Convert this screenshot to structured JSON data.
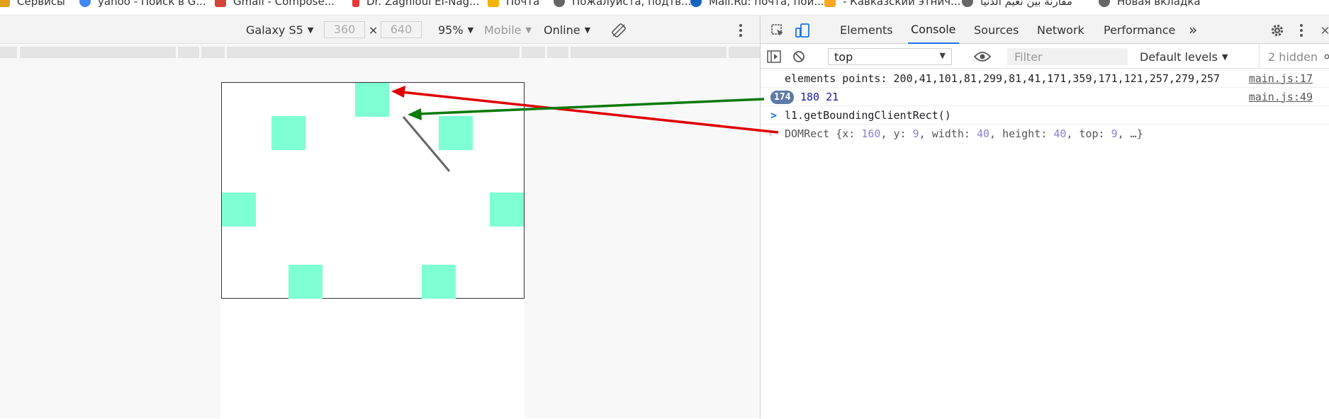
{
  "bookmarks": [
    {
      "label": "Сервисы",
      "color": "#e0a21b",
      "icon": "apps-grid-icon"
    },
    {
      "label": "yahoo - Поиск в G...",
      "color": "#4285f4",
      "icon": "google-icon"
    },
    {
      "label": "Gmail - Compose...",
      "color": "#d44638",
      "icon": "gmail-icon"
    },
    {
      "label": "Dr. Zaghloul El-Nag...",
      "color": "#e53935",
      "icon": "bookmark-icon"
    },
    {
      "label": "Почта",
      "color": "#f4b400",
      "icon": "mail-icon"
    },
    {
      "label": "Пожалуйста, подтв...",
      "color": "#666666",
      "icon": "globe-icon"
    },
    {
      "label": "Mail.Ru: почта, пои...",
      "color": "#1565c0",
      "icon": "mailru-icon"
    },
    {
      "label": "- Кавказский этнич...",
      "color": "#f9a825",
      "icon": "star-icon"
    },
    {
      "label": "مقارنة بين نعيم الدنيا",
      "color": "#666666",
      "icon": "globe-icon"
    },
    {
      "label": "Новая вкладка",
      "color": "#666666",
      "icon": "globe-icon"
    }
  ],
  "device_toolbar": {
    "device": "Galaxy S5",
    "width": "360",
    "times": "×",
    "height": "640",
    "zoom": "95%",
    "type": "Mobile",
    "throttle": "Online"
  },
  "devtools": {
    "tabs": [
      "Elements",
      "Console",
      "Sources",
      "Network",
      "Performance"
    ],
    "active_tab": "Console",
    "more": "»",
    "context": "top",
    "filter_placeholder": "Filter",
    "levels": "Default levels",
    "hidden": "2 hidden"
  },
  "console": {
    "log1": {
      "text": "elements points: 200,41,101,81,299,81,41,171,359,171,121,257,279,257",
      "source": "main.js:17"
    },
    "log2": {
      "count": "174",
      "text": "180 21",
      "source": "main.js:49"
    },
    "input": {
      "prompt": ">",
      "text": "l1.getBoundingClientRect()"
    },
    "result": {
      "arrow": "‹",
      "prefix": "DOMRect {",
      "x_key": "x:",
      "x_val": "160",
      "y_key": "y:",
      "y_val": "9",
      "w_key": "width:",
      "w_val": "40",
      "h_key": "height:",
      "h_val": "40",
      "t_key": "top:",
      "t_val": "9",
      "suffix": ", …}"
    }
  },
  "colors": {
    "square": "#7fffd4",
    "arrow_red": "#e00000",
    "arrow_green": "#0a7a0a",
    "accent": "#1a73e8"
  }
}
